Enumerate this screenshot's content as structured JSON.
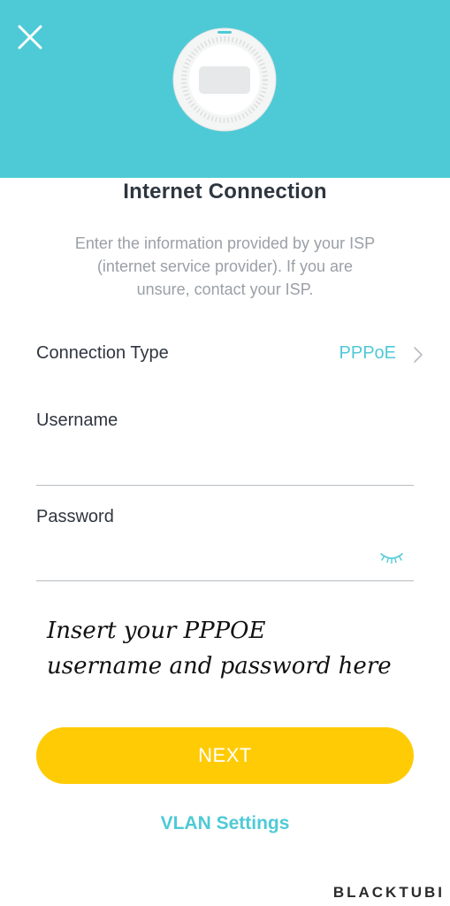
{
  "header": {
    "background_color": "#4ecad6",
    "close_icon": "close-icon",
    "device_image": "access-point-device-image"
  },
  "page": {
    "title": "Internet Connection",
    "description_lines": [
      "Enter the information provided by your ISP",
      "(internet service provider). If you are",
      "unsure, contact your ISP."
    ]
  },
  "connection": {
    "label": "Connection Type",
    "value": "PPPoE",
    "chevron_icon": "chevron-right-icon"
  },
  "fields": {
    "username": {
      "label": "Username",
      "value": "",
      "placeholder": ""
    },
    "password": {
      "label": "Password",
      "value": "",
      "placeholder": "",
      "toggle_icon": "eye-closed-icon"
    }
  },
  "annotation": {
    "lines": [
      "Insert your PPPOE",
      "username and password here"
    ]
  },
  "actions": {
    "next_label": "NEXT",
    "next_color": "#ffcb05",
    "vlan_label": "VLAN Settings"
  },
  "watermark": "BLACKTUBI",
  "accent_color": "#4ecad6"
}
